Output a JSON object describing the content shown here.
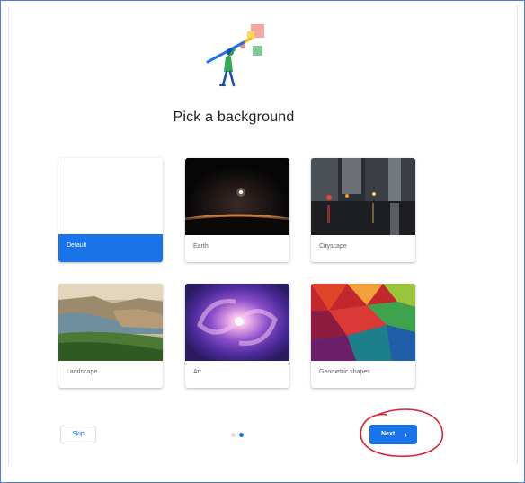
{
  "page": {
    "title": "Pick a background"
  },
  "backgrounds": [
    {
      "label": "Default",
      "selected": true,
      "thumbnail": "blank-white"
    },
    {
      "label": "Earth",
      "selected": false,
      "thumbnail": "earth-horizon-space"
    },
    {
      "label": "Cityscape",
      "selected": false,
      "thumbnail": "rainy-city-street"
    },
    {
      "label": "Landscape",
      "selected": false,
      "thumbnail": "coastal-cliffs"
    },
    {
      "label": "Art",
      "selected": false,
      "thumbnail": "purple-spiral-galaxy"
    },
    {
      "label": "Geometric shapes",
      "selected": false,
      "thumbnail": "colorful-low-poly"
    }
  ],
  "footer": {
    "skip_label": "Skip",
    "next_label": "Next",
    "next_icon": "chevron-right-icon",
    "step_current": 2,
    "step_total": 2
  },
  "colors": {
    "accent": "#1a73e8",
    "annotation": "#d9232e",
    "frame_border": "#4f7fd3"
  },
  "illustration_icon": "person-painting-icon"
}
